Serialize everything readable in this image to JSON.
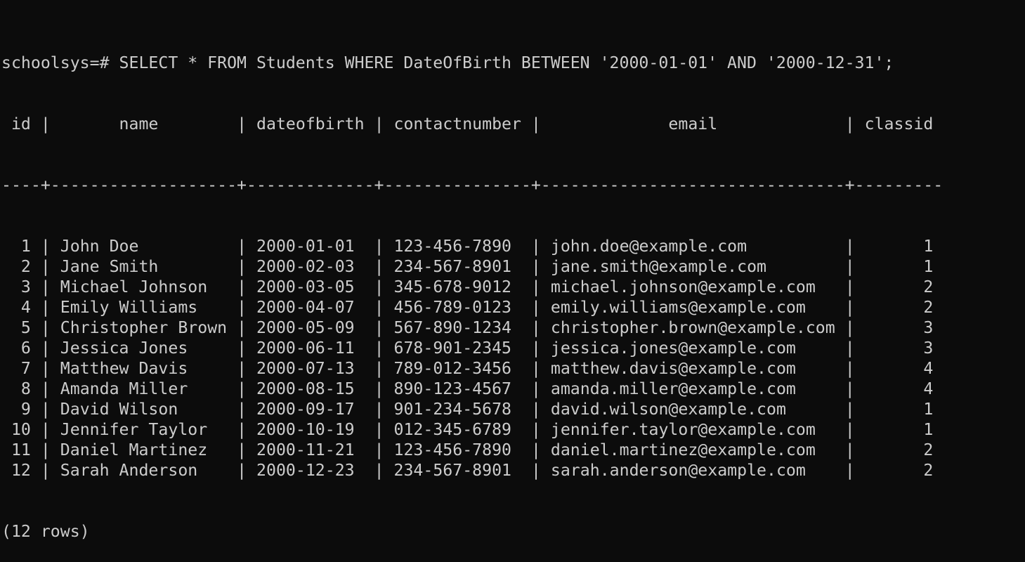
{
  "terminal": {
    "prompt": "schoolsys=# ",
    "command": "SELECT * FROM Students WHERE DateOfBirth BETWEEN '2000-01-01' AND '2000-12-31';",
    "columns": [
      {
        "key": "id",
        "label": "id",
        "align": "right"
      },
      {
        "key": "name",
        "label": "name",
        "align": "left"
      },
      {
        "key": "dateofbirth",
        "label": "dateofbirth",
        "align": "left"
      },
      {
        "key": "contactnumber",
        "label": "contactnumber",
        "align": "left"
      },
      {
        "key": "email",
        "label": "email",
        "align": "left"
      },
      {
        "key": "classid",
        "label": "classid",
        "align": "right"
      }
    ],
    "rows": [
      {
        "id": "1",
        "name": "John Doe",
        "dateofbirth": "2000-01-01",
        "contactnumber": "123-456-7890",
        "email": "john.doe@example.com",
        "classid": "1"
      },
      {
        "id": "2",
        "name": "Jane Smith",
        "dateofbirth": "2000-02-03",
        "contactnumber": "234-567-8901",
        "email": "jane.smith@example.com",
        "classid": "1"
      },
      {
        "id": "3",
        "name": "Michael Johnson",
        "dateofbirth": "2000-03-05",
        "contactnumber": "345-678-9012",
        "email": "michael.johnson@example.com",
        "classid": "2"
      },
      {
        "id": "4",
        "name": "Emily Williams",
        "dateofbirth": "2000-04-07",
        "contactnumber": "456-789-0123",
        "email": "emily.williams@example.com",
        "classid": "2"
      },
      {
        "id": "5",
        "name": "Christopher Brown",
        "dateofbirth": "2000-05-09",
        "contactnumber": "567-890-1234",
        "email": "christopher.brown@example.com",
        "classid": "3"
      },
      {
        "id": "6",
        "name": "Jessica Jones",
        "dateofbirth": "2000-06-11",
        "contactnumber": "678-901-2345",
        "email": "jessica.jones@example.com",
        "classid": "3"
      },
      {
        "id": "7",
        "name": "Matthew Davis",
        "dateofbirth": "2000-07-13",
        "contactnumber": "789-012-3456",
        "email": "matthew.davis@example.com",
        "classid": "4"
      },
      {
        "id": "8",
        "name": "Amanda Miller",
        "dateofbirth": "2000-08-15",
        "contactnumber": "890-123-4567",
        "email": "amanda.miller@example.com",
        "classid": "4"
      },
      {
        "id": "9",
        "name": "David Wilson",
        "dateofbirth": "2000-09-17",
        "contactnumber": "901-234-5678",
        "email": "david.wilson@example.com",
        "classid": "1"
      },
      {
        "id": "10",
        "name": "Jennifer Taylor",
        "dateofbirth": "2000-10-19",
        "contactnumber": "012-345-6789",
        "email": "jennifer.taylor@example.com",
        "classid": "1"
      },
      {
        "id": "11",
        "name": "Daniel Martinez",
        "dateofbirth": "2000-11-21",
        "contactnumber": "123-456-7890",
        "email": "daniel.martinez@example.com",
        "classid": "2"
      },
      {
        "id": "12",
        "name": "Sarah Anderson",
        "dateofbirth": "2000-12-23",
        "contactnumber": "234-567-8901",
        "email": "sarah.anderson@example.com",
        "classid": "2"
      }
    ],
    "footer": "(12 rows)",
    "colors": {
      "background": "#0c0c0c",
      "foreground": "#cccccc"
    }
  }
}
